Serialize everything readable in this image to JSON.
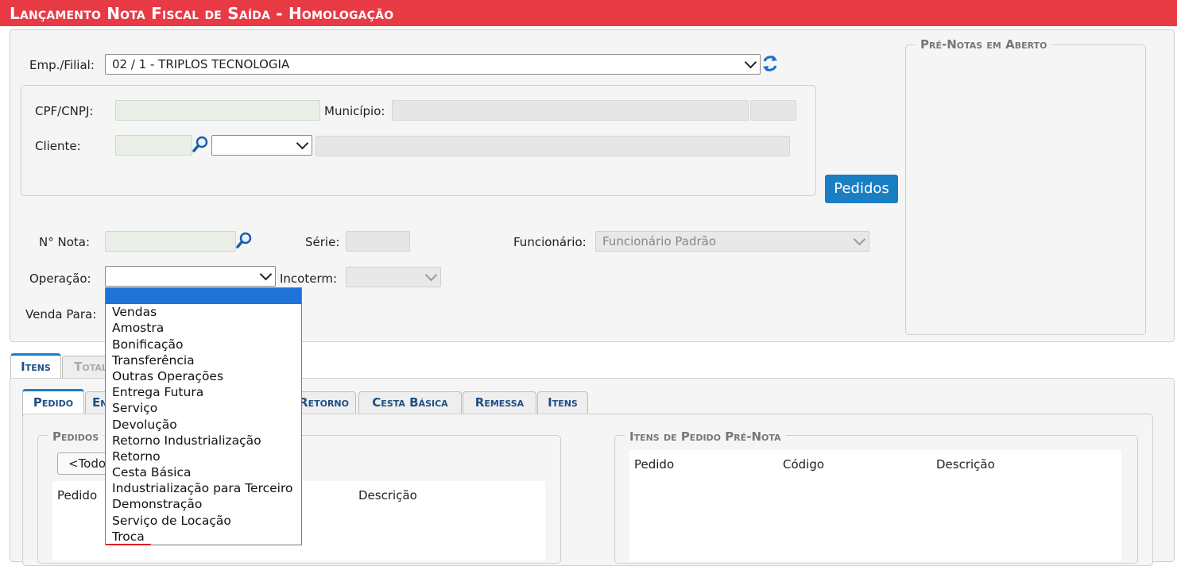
{
  "title": "Lançamento Nota Fiscal de Saída  - Homologação",
  "form": {
    "emp_label": "Emp./Filial:",
    "emp_value": "02 / 1 - TRIPLOS TECNOLOGIA",
    "cpf_label": "CPF/CNPJ:",
    "municipio_label": "Município:",
    "cliente_label": "Cliente:",
    "pedidos_button": "Pedidos",
    "nota_label": "N° Nota:",
    "serie_label": "Série:",
    "funcionario_label": "Funcionário:",
    "funcionario_value": "Funcionário Padrão",
    "operacao_label": "Operação:",
    "incoterm_label": "Incoterm:",
    "venda_para_label": "Venda Para:"
  },
  "pre_notas": {
    "legend": "Pré-Notas em Aberto"
  },
  "outer_tabs": [
    "Itens",
    "Total"
  ],
  "inner_tabs": [
    "Pedido",
    "En",
    "Retorno",
    "Cesta Básica",
    "Remessa",
    "Itens"
  ],
  "pedidos_box": {
    "legend": "Pedidos",
    "button": "<Todo",
    "columns": [
      "Pedido",
      "Descrição"
    ]
  },
  "itens_box": {
    "legend": "Itens de Pedido Pré-Nota",
    "columns": [
      "Pedido",
      "Código",
      "Descrição"
    ]
  },
  "operacao_options": [
    "",
    "Vendas",
    "Amostra",
    "Bonificação",
    "Transferência",
    "Outras Operações",
    "Entrega Futura",
    "Serviço",
    "Devolução",
    "Retorno Industrialização",
    "Retorno",
    "Cesta Básica",
    "Industrialização para Terceiro",
    "Demonstração",
    "Serviço de Locação",
    "Troca"
  ],
  "colors": {
    "title_bar": "#e73a45",
    "accent": "#1a7ec3",
    "selection": "#1e73d9"
  }
}
